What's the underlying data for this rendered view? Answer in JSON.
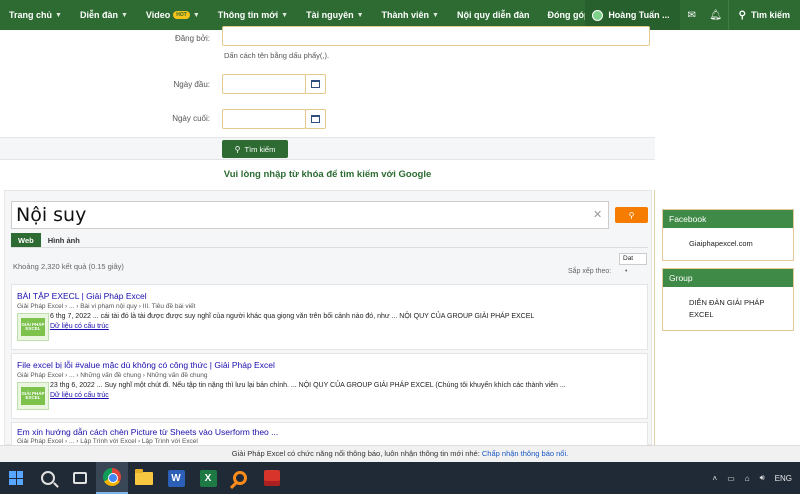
{
  "nav": {
    "items": [
      {
        "label": "Trang chủ",
        "caret": true
      },
      {
        "label": "Diễn đàn",
        "caret": true
      },
      {
        "label": "Video",
        "caret": true,
        "badge": "HOT"
      },
      {
        "label": "Thông tin mới",
        "caret": true
      },
      {
        "label": "Tài nguyên",
        "caret": true
      },
      {
        "label": "Thành viên",
        "caret": true
      },
      {
        "label": "Nội quy diễn đàn",
        "caret": false
      },
      {
        "label": "Đóng góp",
        "caret": false
      }
    ],
    "user_name": "Hoàng Tuấn ...",
    "search_label": "Tìm kiếm"
  },
  "form": {
    "posted_by_label": "Đăng bởi:",
    "posted_by_value": "",
    "posted_by_hint": "Dấn cách tên bằng dấu phẩy(,).",
    "start_date_label": "Ngày đầu:",
    "end_date_label": "Ngày cuối:",
    "submit_label": "Tìm kiếm",
    "google_title": "Vui lòng nhập từ khóa để tìm kiếm với Google"
  },
  "cse": {
    "query": "Nội suy",
    "tabs": [
      {
        "label": "Web",
        "active": true
      },
      {
        "label": "Hình ảnh",
        "active": false
      }
    ],
    "result_count": "Khoảng 2,320 kết quả (0.15 giây)",
    "sort_value": "Dat",
    "sort_label": "Sắp xếp theo:",
    "results": [
      {
        "title": "BÀI TẬP EXECL | Giải Pháp Excel",
        "crumb": "Giải Pháp Excel › ... › Bài vi phạm nội quy › III. Tiêu đề bài viết",
        "snippet": "6 thg 7, 2022 ... cái tài đó là tài được được suy nghĩ của người khác qua giọng văn trên bối cảnh nào đó, như ... NỘI QUY CỦA GROUP GIẢI PHÁP EXCEL",
        "link": "Dữ liệu có cấu trúc"
      },
      {
        "title": "File excel bị lỗi #value mặc dù không có công thức | Giải Pháp Excel",
        "crumb": "Giải Pháp Excel › ... › Những vấn đề chung › Những vấn đề chung",
        "snippet": "23 thg 6, 2022 ... Suy nghĩ một chút đi. Nếu tập tin nặng thì lưu lại bản chính. ... NỘI QUY CỦA GROUP GIẢI PHÁP EXCEL (Chúng tôi khuyến khích các thành viên ...",
        "link": "Dữ liệu có cấu trúc"
      },
      {
        "title": "Em xin hướng dẫn cách chèn Picture từ Sheets vào Userform theo ...",
        "crumb": "Giải Pháp Excel › ... › Lập Trình với Excel › Lập Trình với Excel",
        "snippet": "",
        "link": ""
      }
    ],
    "thumb_text": "GIẢI PHÁP EXCEL"
  },
  "sidebar": {
    "facebook_title": "Facebook",
    "facebook_link": "Giaiphapexcel.com",
    "group_title": "Group",
    "group_text": "DIỄN ĐÀN GIẢI PHÁP EXCEL"
  },
  "notification": {
    "text": "Giải Pháp Excel có chức năng nổi thông báo, luôn nhận thông tin mới nhé: ",
    "link": "Chấp nhận thông báo nổi."
  },
  "taskbar": {
    "lang": "ENG"
  },
  "colors": {
    "brand_green": "#2d6b32",
    "orange": "#f57c00",
    "link_blue": "#1a0dab"
  }
}
